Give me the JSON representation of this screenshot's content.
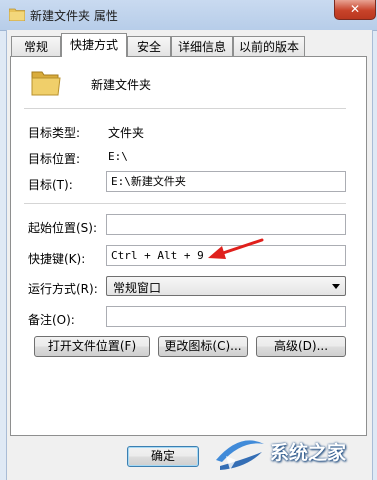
{
  "window": {
    "title": "新建文件夹 属性",
    "close_label": "✕"
  },
  "tabs": [
    {
      "label": "常规"
    },
    {
      "label": "快捷方式"
    },
    {
      "label": "安全"
    },
    {
      "label": "详细信息"
    },
    {
      "label": "以前的版本"
    }
  ],
  "active_tab": "快捷方式",
  "shortcut": {
    "name": "新建文件夹",
    "target_type_label": "目标类型:",
    "target_type_value": "文件夹",
    "target_location_label": "目标位置:",
    "target_location_value": "E:\\",
    "target_label": "目标(T):",
    "target_value": "E:\\新建文件夹",
    "start_in_label": "起始位置(S):",
    "start_in_value": "",
    "hotkey_label": "快捷键(K):",
    "hotkey_value": "Ctrl + Alt + 9",
    "run_label": "运行方式(R):",
    "run_value": "常规窗口",
    "comment_label": "备注(O):",
    "comment_value": ""
  },
  "buttons": {
    "open_location": "打开文件位置(F)",
    "change_icon": "更改图标(C)...",
    "advanced": "高级(D)...",
    "ok": "确定"
  },
  "watermark": {
    "text": "系统之家"
  },
  "colors": {
    "annotation_arrow": "#e0201c",
    "close_button": "#c8432a"
  }
}
